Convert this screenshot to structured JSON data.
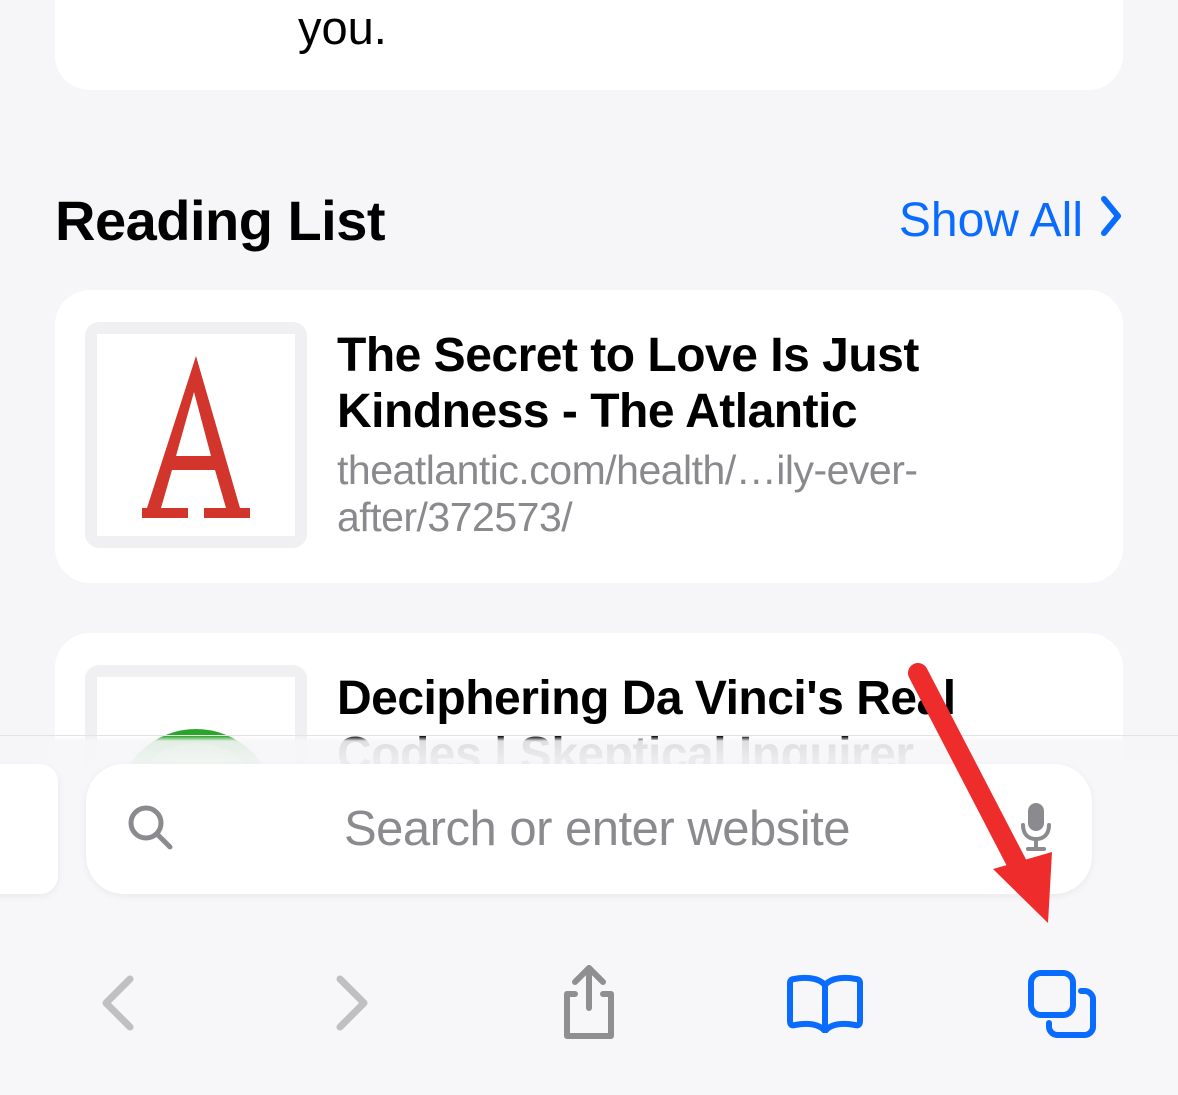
{
  "top_card": {
    "text_fragment": "you."
  },
  "section": {
    "title": "Reading List",
    "show_all_label": "Show All"
  },
  "items": [
    {
      "title": "The Secret to Love Is Just Kindness - The Atlantic",
      "url": "theatlantic.com/health/…ily-ever-after/372573/"
    },
    {
      "title": "Deciphering Da Vinci's Real Codes | Skeptical Inquirer",
      "url": ""
    }
  ],
  "search": {
    "placeholder": "Search or enter website"
  },
  "colors": {
    "accent": "#0a6cff",
    "atlantic_red": "#d1352b"
  }
}
